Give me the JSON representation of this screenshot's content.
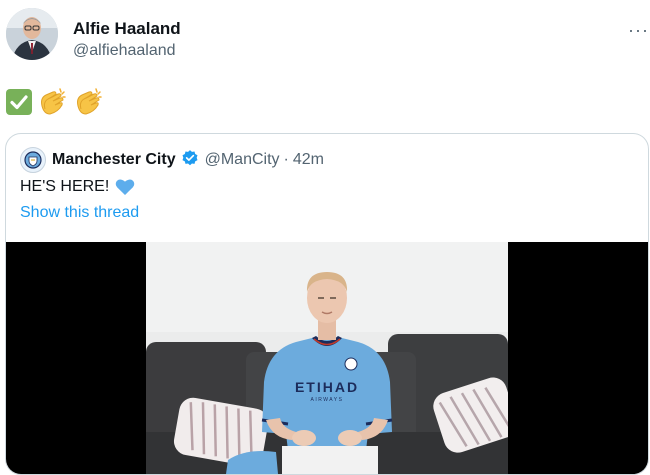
{
  "tweet": {
    "author_name": "Alfie Haaland",
    "author_handle": "@alfiehaaland",
    "more_label": "···",
    "emoji_icons": [
      "check-mark-icon",
      "clapping-hands-icon",
      "clapping-hands-icon"
    ]
  },
  "quote": {
    "name": "Manchester City",
    "handle": "@ManCity",
    "separator": "·",
    "time": "42m",
    "text": "HE'S HERE!",
    "text_emoji_icon": "blue-heart-icon",
    "thread_link": "Show this thread",
    "media": {
      "type": "video",
      "shirt_text": "ETIHAD",
      "shirt_subtext": "AIRWAYS"
    }
  },
  "colors": {
    "link": "#1d9bf0",
    "secondary_text": "#536471",
    "border": "#cfd9de",
    "verified": "#1d9bf0",
    "check_green": "#78b159",
    "heart_blue": "#5dadec",
    "shirt_blue": "#6cabdd"
  }
}
